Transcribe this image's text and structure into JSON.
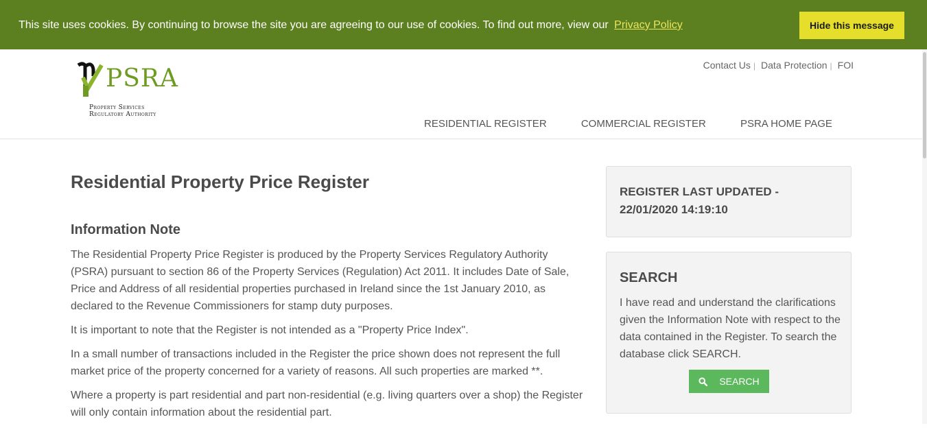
{
  "cookie": {
    "message": "This site uses cookies. By continuing to browse the site you are agreeing to our use of cookies. To find out more, view our",
    "policy_link": "Privacy Policy",
    "hide_button": "Hide this message"
  },
  "logo": {
    "name": "PSRA",
    "subtitle_line1": "Property Services",
    "subtitle_line2": "Regulatory Authority"
  },
  "top_links": [
    "Contact Us",
    "Data Protection",
    "FOI"
  ],
  "nav": [
    "RESIDENTIAL REGISTER",
    "COMMERCIAL REGISTER",
    "PSRA HOME PAGE"
  ],
  "main": {
    "title": "Residential Property Price Register",
    "section_heading": "Information Note",
    "paragraphs": [
      "The Residential Property Price Register is produced by the Property Services Regulatory Authority (PSRA) pursuant to section 86 of the Property Services (Regulation) Act 2011. It includes Date of Sale, Price and Address of all residential properties purchased in Ireland since the 1st January 2010, as declared to the Revenue Commissioners for stamp duty purposes.",
      "It is important to note that the Register is not intended as a \"Property Price Index\".",
      "In a small number of transactions included in the Register the price shown does not represent the full market price of the property concerned for a variety of reasons. All such properties are marked **.",
      "Where a property is part residential and part non-residential (e.g. living quarters over a shop) the Register will only contain information about the residential part."
    ]
  },
  "sidebar": {
    "updated_label": "REGISTER LAST UPDATED -",
    "updated_value": "22/01/2020 14:19:10",
    "search_heading": "SEARCH",
    "search_text": "I have read and understand the clarifications given the Information Note with respect to the data contained in the Register. To search the database click SEARCH.",
    "search_button": "SEARCH"
  },
  "colors": {
    "cookie_bar": "#5c7f1f",
    "cookie_button": "#e5de2b",
    "brand_green": "#6f9b22",
    "search_button": "#5cb85c"
  },
  "icons": [
    "psra-logo-icon",
    "search-icon"
  ]
}
